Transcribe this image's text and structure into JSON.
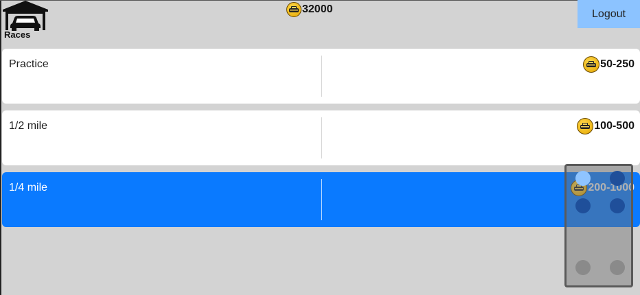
{
  "header": {
    "home_icon": "garage-car-icon",
    "section_label": "Races",
    "coin_icon": "taxi-coin-icon",
    "balance": "32000",
    "logout_label": "Logout"
  },
  "races": [
    {
      "name": "Practice",
      "prize": "50-250",
      "selected": false
    },
    {
      "name": "1/2 mile",
      "prize": "100-500",
      "selected": false
    },
    {
      "name": "1/4 mile",
      "prize": "200-1000",
      "selected": true
    }
  ],
  "colors": {
    "background": "#d3d3d3",
    "selected_row": "#0a7aff",
    "logout_button": "#8cc3ff",
    "coin": "#f2c230"
  },
  "controller_overlay": {
    "icon": "gamepad-overlay",
    "buttons": [
      "top-left",
      "top-right",
      "middle-left",
      "middle-right",
      "bottom-left",
      "bottom-right"
    ]
  }
}
